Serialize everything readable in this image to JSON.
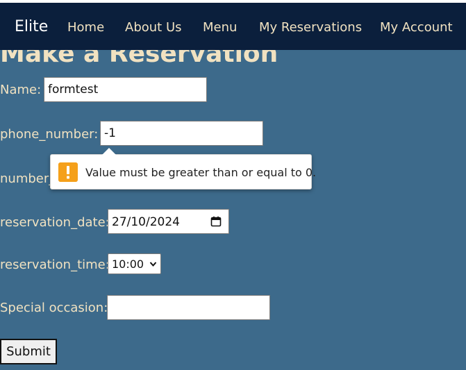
{
  "nav": {
    "brand": "Elite",
    "links": [
      "Home",
      "About Us",
      "Menu",
      "My Reservations",
      "My Account"
    ]
  },
  "page": {
    "title": "Make a Reservation"
  },
  "form": {
    "name_label": "Name:",
    "name_value": "formtest",
    "phone_label": "phone_number:",
    "phone_value": "-1",
    "guests_label": "number_",
    "date_label": "reservation_date:",
    "date_value": "27/10/2024",
    "time_label": "reservation_time:",
    "time_value": "10:00",
    "occasion_label": "Special occasion:",
    "occasion_value": "",
    "submit_label": "Submit"
  },
  "validation": {
    "message": "Value must be greater than or equal to 0."
  },
  "colors": {
    "navbar_bg": "#0b1f3c",
    "page_bg": "#3d6a8b",
    "text_cream": "#f1e2c1",
    "warning": "#f5a01a"
  },
  "icons": {
    "calendar": "calendar-icon",
    "select_arrow": "chevron-down-icon",
    "warning": "warning-icon"
  }
}
